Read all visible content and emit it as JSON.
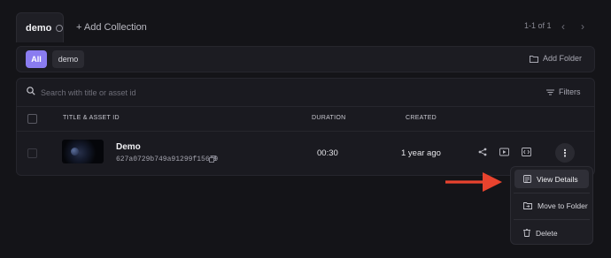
{
  "collections": {
    "active_tab": "demo",
    "add_label": "+ Add Collection",
    "pagination": "1-1 of 1"
  },
  "folders": {
    "chips": [
      "All",
      "demo"
    ],
    "add_folder_label": "Add Folder"
  },
  "search": {
    "placeholder": "Search with title or asset id",
    "filters_label": "Filters"
  },
  "table": {
    "columns": [
      "TITLE & ASSET ID",
      "DURATION",
      "CREATED"
    ],
    "rows": [
      {
        "title": "Demo",
        "asset_id": "627a0729b749a91299f15679",
        "duration": "00:30",
        "created": "1 year ago"
      }
    ]
  },
  "menu": {
    "items": [
      "View Details",
      "Move to Folder",
      "Delete"
    ],
    "highlighted": "View Details"
  },
  "colors": {
    "accent": "#8a7cf0",
    "annotation_arrow": "#e8432e",
    "background": "#141418"
  },
  "icons": [
    "info-icon",
    "chevron-left-icon",
    "chevron-right-icon",
    "folder-icon",
    "search-icon",
    "filter-icon",
    "copy-icon",
    "share-icon",
    "play-icon",
    "embed-icon",
    "more-icon",
    "details-icon",
    "move-folder-icon",
    "trash-icon",
    "annotation-arrow"
  ]
}
